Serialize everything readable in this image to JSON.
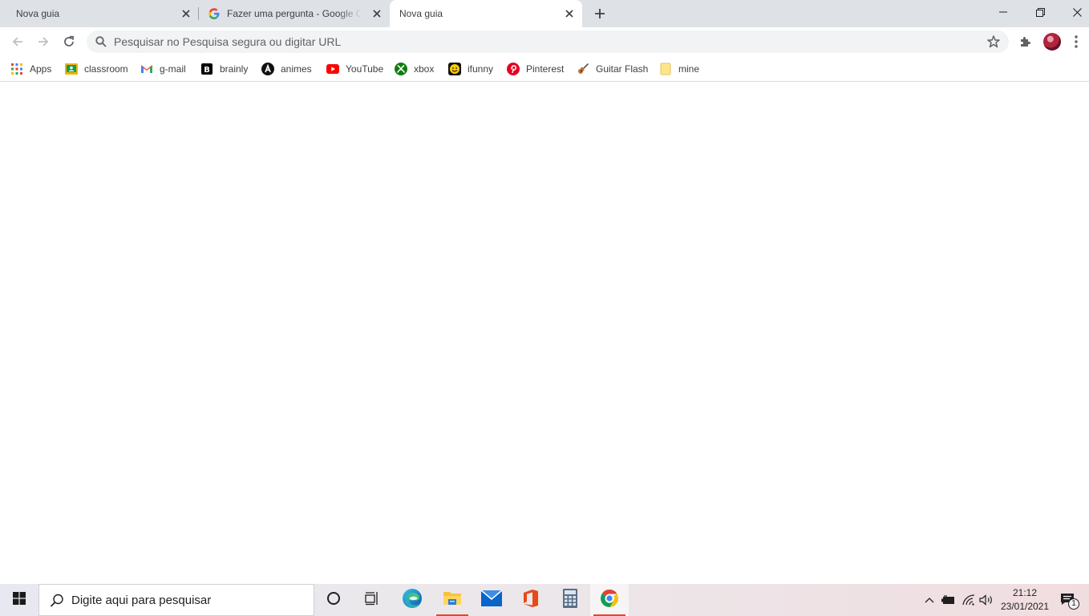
{
  "tabs": [
    {
      "title": "Nova guia",
      "active": false
    },
    {
      "title": "Fazer uma pergunta - Google Ch",
      "active": false,
      "favicon": "google-g-icon"
    },
    {
      "title": "Nova guia",
      "active": true
    }
  ],
  "omnibox": {
    "placeholder": "Pesquisar no Pesquisa segura ou digitar URL"
  },
  "bookmarks": [
    {
      "label": "Apps",
      "icon": "apps-grid-icon"
    },
    {
      "label": "classroom",
      "icon": "classroom-icon"
    },
    {
      "label": "g-mail",
      "icon": "gmail-icon"
    },
    {
      "label": "brainly",
      "icon": "brainly-icon"
    },
    {
      "label": "animes",
      "icon": "animes-icon"
    },
    {
      "label": "YouTube",
      "icon": "youtube-icon"
    },
    {
      "label": "xbox",
      "icon": "xbox-icon"
    },
    {
      "label": "ifunny",
      "icon": "ifunny-icon"
    },
    {
      "label": "Pinterest",
      "icon": "pinterest-icon"
    },
    {
      "label": "Guitar Flash",
      "icon": "guitar-icon"
    },
    {
      "label": "mine",
      "icon": "folder-icon"
    }
  ],
  "taskbar": {
    "search_placeholder": "Digite aqui para pesquisar",
    "time": "21:12",
    "date": "23/01/2021",
    "notification_count": "1"
  },
  "colors": {
    "tabstrip": "#dee1e6",
    "omnibox": "#f1f3f4",
    "running_indicator": "#d84a3c"
  }
}
